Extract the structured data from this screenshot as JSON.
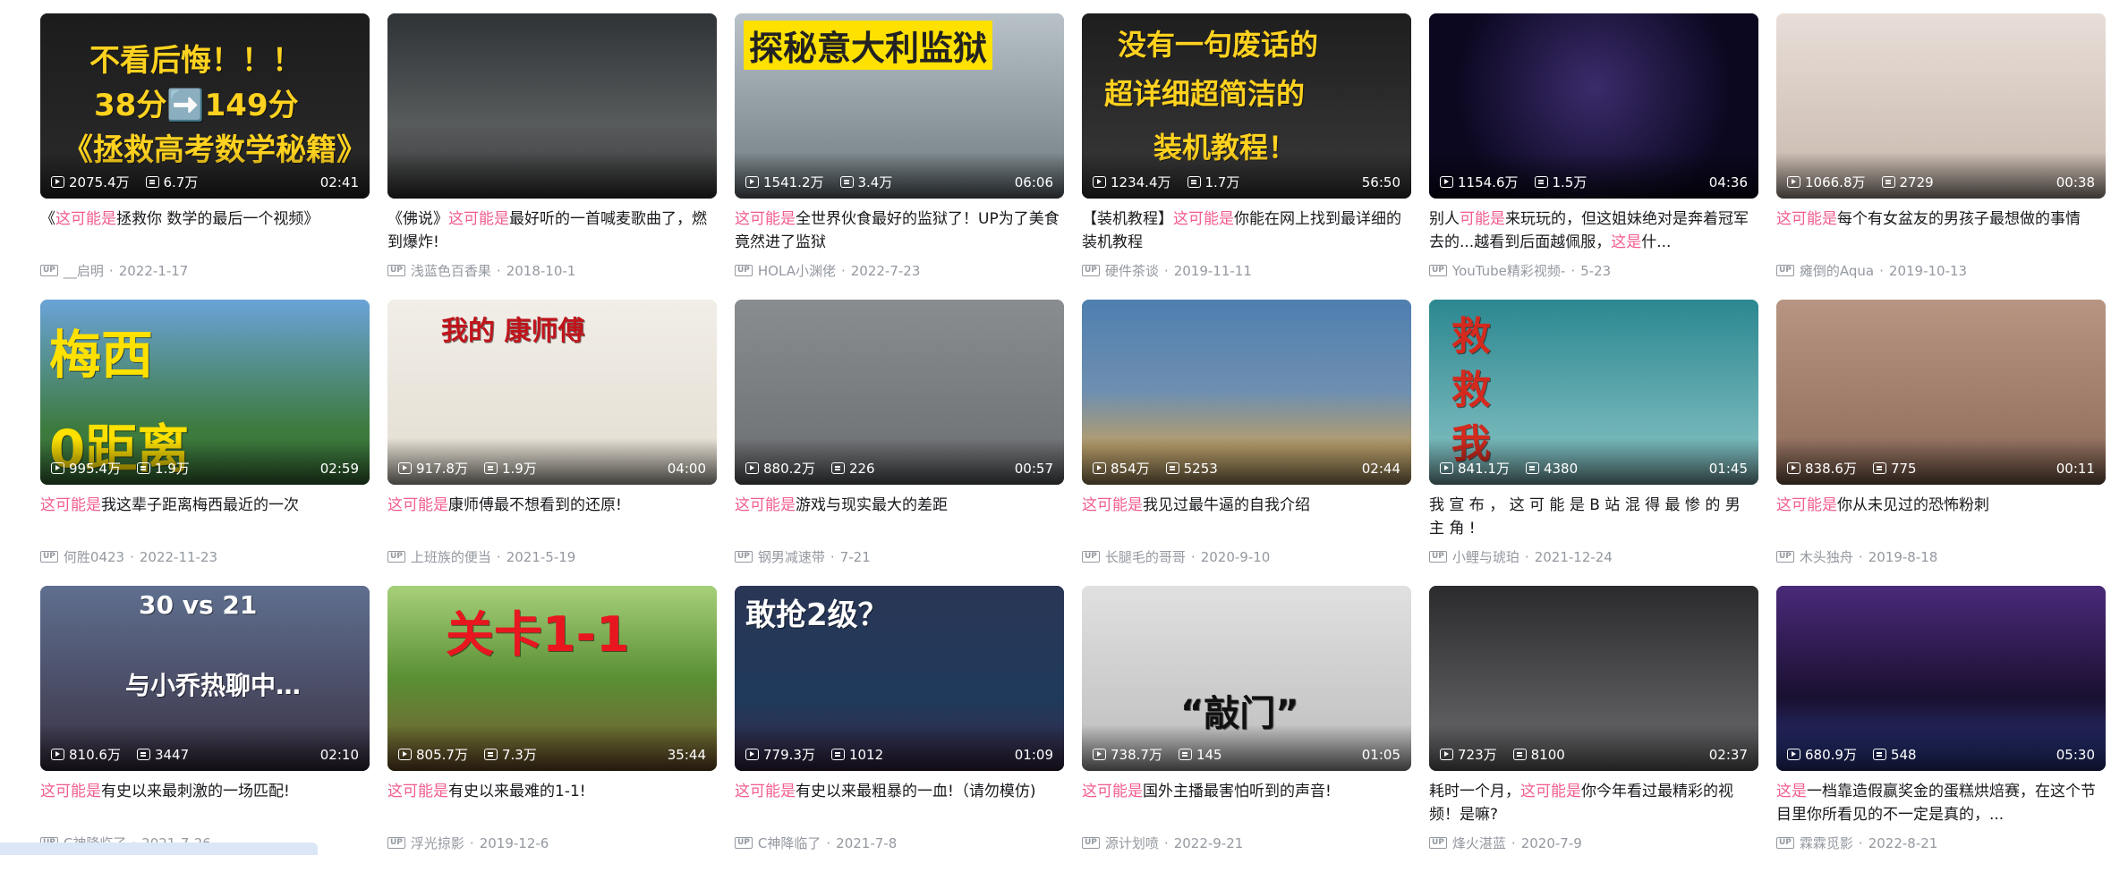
{
  "videos": [
    {
      "title_parts": [
        [
          "《",
          "n"
        ],
        [
          "这可能是",
          "h"
        ],
        [
          "拯救你 数学的最后一个视频》",
          "n"
        ]
      ],
      "views": "2075.4万",
      "danmaku": "6.7万",
      "duration": "02:41",
      "author": "__启明",
      "date": "2022-1-17",
      "overlay": "不看后悔！！！\n38分➡️149分\n《拯救高考数学秘籍》",
      "bg": "#1b1b1b"
    },
    {
      "title_parts": [
        [
          "《佛说》",
          "n"
        ],
        [
          "这可能是",
          "h"
        ],
        [
          "最好听的一首喊麦歌曲了，燃到爆炸!",
          "n"
        ]
      ],
      "views": "",
      "danmaku": "",
      "duration": "",
      "author": "浅蓝色百香果",
      "date": "2018-10-1",
      "overlay": "",
      "bg": "#3b3d3f"
    },
    {
      "title_parts": [
        [
          "这可能是",
          "h"
        ],
        [
          "全世界伙食最好的监狱了！UP为了美食竟然进了监狱",
          "n"
        ]
      ],
      "views": "1541.2万",
      "danmaku": "3.4万",
      "duration": "06:06",
      "author": "HOLA小渊佬",
      "date": "2022-7-23",
      "overlay": "探秘意大利监狱",
      "bg": "#8d969c"
    },
    {
      "title_parts": [
        [
          "【装机教程】",
          "n"
        ],
        [
          "这可能是",
          "h"
        ],
        [
          "你能在网上找到最详细的装机教程",
          "n"
        ]
      ],
      "views": "1234.4万",
      "danmaku": "1.7万",
      "duration": "56:50",
      "author": "硬件茶谈",
      "date": "2019-11-11",
      "overlay": "没有一句废话的\n超详细超简洁的\n装机教程！",
      "bg": "#2a2a2a"
    },
    {
      "title_parts": [
        [
          "别人",
          "n"
        ],
        [
          "可能是",
          "h"
        ],
        [
          "来玩玩的，但这姐妹绝对是奔着冠军去的...越看到后面越佩服，",
          "n"
        ],
        [
          "这是",
          "h"
        ],
        [
          "什...",
          "n"
        ]
      ],
      "views": "1154.6万",
      "danmaku": "1.5万",
      "duration": "04:36",
      "author": "YouTube精彩视频-",
      "date": "5-23",
      "overlay": "",
      "bg": "#1a1433"
    },
    {
      "title_parts": [
        [
          "这可能是",
          "h"
        ],
        [
          "每个有女盆友的男孩子最想做的事情",
          "n"
        ]
      ],
      "views": "1066.8万",
      "danmaku": "2729",
      "duration": "00:38",
      "author": "瘫倒的Aqua",
      "date": "2019-10-13",
      "overlay": "",
      "bg": "#d9cbc4"
    },
    {
      "title_parts": [
        [
          "这可能是",
          "h"
        ],
        [
          "我这辈子距离梅西最近的一次",
          "n"
        ]
      ],
      "views": "995.4万",
      "danmaku": "1.9万",
      "duration": "02:59",
      "author": "何胜0423",
      "date": "2022-11-23",
      "overlay": "梅西\n0距离",
      "bg": "#3d7a3d"
    },
    {
      "title_parts": [
        [
          "这可能是",
          "h"
        ],
        [
          "康师傅最不想看到的还原!",
          "n"
        ]
      ],
      "views": "917.8万",
      "danmaku": "1.9万",
      "duration": "04:00",
      "author": "上班族的便当",
      "date": "2021-5-19",
      "overlay": "我的   康师傅",
      "bg": "#e9e6df"
    },
    {
      "title_parts": [
        [
          "这可能是",
          "h"
        ],
        [
          "游戏与现实最大的差距",
          "n"
        ]
      ],
      "views": "880.2万",
      "danmaku": "226",
      "duration": "00:57",
      "author": "钢男减速带",
      "date": "7-21",
      "overlay": "",
      "bg": "#77797c"
    },
    {
      "title_parts": [
        [
          "这可能是",
          "h"
        ],
        [
          "我见过最牛逼的自我介绍",
          "n"
        ]
      ],
      "views": "854万",
      "danmaku": "5253",
      "duration": "02:44",
      "author": "长腿毛的哥哥",
      "date": "2020-9-10",
      "overlay": "",
      "bg": "#4f6e8f"
    },
    {
      "title_parts": [
        [
          "我 宣 布 ， 这 可 能 是 B 站 混 得 最 惨 的 男 主 角 !",
          "n"
        ]
      ],
      "views": "841.1万",
      "danmaku": "4380",
      "duration": "01:45",
      "author": "小鲤与琥珀",
      "date": "2021-12-24",
      "overlay": "救\n救\n我",
      "bg": "#3a7f86"
    },
    {
      "title_parts": [
        [
          "这可能是",
          "h"
        ],
        [
          "你从未见过的恐怖粉刺",
          "n"
        ]
      ],
      "views": "838.6万",
      "danmaku": "775",
      "duration": "00:11",
      "author": "木头独舟",
      "date": "2019-8-18",
      "overlay": "",
      "bg": "#a8836f"
    },
    {
      "title_parts": [
        [
          "这可能是",
          "h"
        ],
        [
          "有史以来最刺激的一场匹配!",
          "n"
        ]
      ],
      "views": "810.6万",
      "danmaku": "3447",
      "duration": "02:10",
      "author": "C神降临了",
      "date": "2021-7-26",
      "overlay": "30 vs 21\n与小乔热聊中…",
      "bg": "#4e4a5a"
    },
    {
      "title_parts": [
        [
          "这可能是",
          "h"
        ],
        [
          "有史以来最难的1-1!",
          "n"
        ]
      ],
      "views": "805.7万",
      "danmaku": "7.3万",
      "duration": "35:44",
      "author": "浮光掠影",
      "date": "2019-12-6",
      "overlay": "关卡1-1",
      "bg": "#7aa84a"
    },
    {
      "title_parts": [
        [
          "这可能是",
          "h"
        ],
        [
          "有史以来最粗暴的一血!（请勿模仿)",
          "n"
        ]
      ],
      "views": "779.3万",
      "danmaku": "1012",
      "duration": "01:09",
      "author": "C神降临了",
      "date": "2021-7-8",
      "overlay": "敢抢2级？",
      "bg": "#2d3d5a"
    },
    {
      "title_parts": [
        [
          "这可能是",
          "h"
        ],
        [
          "国外主播最害怕听到的声音!",
          "n"
        ]
      ],
      "views": "738.7万",
      "danmaku": "145",
      "duration": "01:05",
      "author": "源计划喷",
      "date": "2022-9-21",
      "overlay": "“敲门”",
      "bg": "#cfcfcf"
    },
    {
      "title_parts": [
        [
          "耗时一个月，",
          "n"
        ],
        [
          "这可能是",
          "h"
        ],
        [
          "你今年看过最精彩的视频！是嘛?",
          "n"
        ]
      ],
      "views": "723万",
      "danmaku": "8100",
      "duration": "02:37",
      "author": "烽火湛蓝",
      "date": "2020-7-9",
      "overlay": "",
      "bg": "#3b3b3d"
    },
    {
      "title_parts": [
        [
          "这是",
          "h"
        ],
        [
          "一档靠造假赢奖金的蛋糕烘焙赛，在这个节目里你所看见的不一定是真的，...",
          "n"
        ]
      ],
      "views": "680.9万",
      "danmaku": "548",
      "duration": "05:30",
      "author": "霖霖觅影",
      "date": "2022-8-21",
      "overlay": "",
      "bg": "#1d1430"
    }
  ],
  "colors": {
    "accent": "#f25d8e",
    "meta": "#9499a0",
    "title": "#18191c"
  },
  "labels": {
    "up_badge": "UP"
  }
}
